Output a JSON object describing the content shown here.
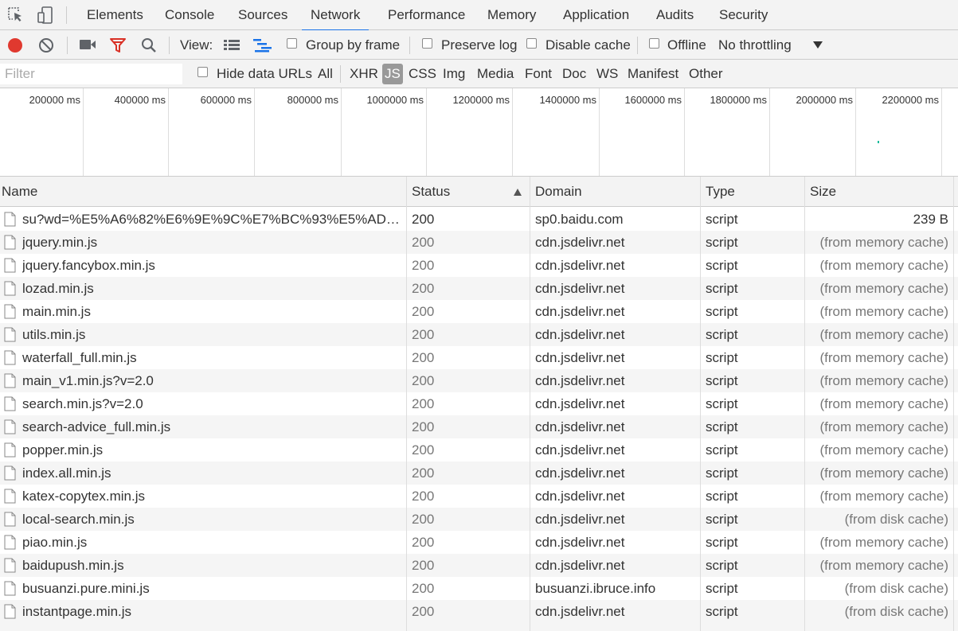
{
  "tabs": [
    "Elements",
    "Console",
    "Sources",
    "Network",
    "Performance",
    "Memory",
    "Application",
    "Audits",
    "Security"
  ],
  "active_tab": "Network",
  "toolbar": {
    "view_label": "View:",
    "group_by_frame": "Group by frame",
    "preserve_log": "Preserve log",
    "disable_cache": "Disable cache",
    "offline": "Offline",
    "throttling": "No throttling",
    "record_color": "#e0392f",
    "filter_icon_color": "#d93025"
  },
  "filterbar": {
    "placeholder": "Filter",
    "hide_data_urls": "Hide data URLs",
    "types": [
      "All",
      "XHR",
      "JS",
      "CSS",
      "Img",
      "Media",
      "Font",
      "Doc",
      "WS",
      "Manifest",
      "Other"
    ],
    "active_type": "JS"
  },
  "overview": {
    "ticks": [
      "200000 ms",
      "400000 ms",
      "600000 ms",
      "800000 ms",
      "1000000 ms",
      "1200000 ms",
      "1400000 ms",
      "1600000 ms",
      "1800000 ms",
      "2000000 ms",
      "2200000 ms"
    ]
  },
  "table": {
    "headers": {
      "name": "Name",
      "status": "Status",
      "domain": "Domain",
      "type": "Type",
      "size": "Size"
    },
    "sort_column": "Status",
    "rows": [
      {
        "name": "su?wd=%E5%A6%82%E6%9E%9C%E7%BC%93%E5%AD%98%...",
        "status": "200",
        "domain": "sp0.baidu.com",
        "type": "script",
        "size": "239 B"
      },
      {
        "name": "jquery.min.js",
        "status": "200",
        "domain": "cdn.jsdelivr.net",
        "type": "script",
        "size": "(from memory cache)"
      },
      {
        "name": "jquery.fancybox.min.js",
        "status": "200",
        "domain": "cdn.jsdelivr.net",
        "type": "script",
        "size": "(from memory cache)"
      },
      {
        "name": "lozad.min.js",
        "status": "200",
        "domain": "cdn.jsdelivr.net",
        "type": "script",
        "size": "(from memory cache)"
      },
      {
        "name": "main.min.js",
        "status": "200",
        "domain": "cdn.jsdelivr.net",
        "type": "script",
        "size": "(from memory cache)"
      },
      {
        "name": "utils.min.js",
        "status": "200",
        "domain": "cdn.jsdelivr.net",
        "type": "script",
        "size": "(from memory cache)"
      },
      {
        "name": "waterfall_full.min.js",
        "status": "200",
        "domain": "cdn.jsdelivr.net",
        "type": "script",
        "size": "(from memory cache)"
      },
      {
        "name": "main_v1.min.js?v=2.0",
        "status": "200",
        "domain": "cdn.jsdelivr.net",
        "type": "script",
        "size": "(from memory cache)"
      },
      {
        "name": "search.min.js?v=2.0",
        "status": "200",
        "domain": "cdn.jsdelivr.net",
        "type": "script",
        "size": "(from memory cache)"
      },
      {
        "name": "search-advice_full.min.js",
        "status": "200",
        "domain": "cdn.jsdelivr.net",
        "type": "script",
        "size": "(from memory cache)"
      },
      {
        "name": "popper.min.js",
        "status": "200",
        "domain": "cdn.jsdelivr.net",
        "type": "script",
        "size": "(from memory cache)"
      },
      {
        "name": "index.all.min.js",
        "status": "200",
        "domain": "cdn.jsdelivr.net",
        "type": "script",
        "size": "(from memory cache)"
      },
      {
        "name": "katex-copytex.min.js",
        "status": "200",
        "domain": "cdn.jsdelivr.net",
        "type": "script",
        "size": "(from memory cache)"
      },
      {
        "name": "local-search.min.js",
        "status": "200",
        "domain": "cdn.jsdelivr.net",
        "type": "script",
        "size": "(from disk cache)"
      },
      {
        "name": "piao.min.js",
        "status": "200",
        "domain": "cdn.jsdelivr.net",
        "type": "script",
        "size": "(from memory cache)"
      },
      {
        "name": "baidupush.min.js",
        "status": "200",
        "domain": "cdn.jsdelivr.net",
        "type": "script",
        "size": "(from memory cache)"
      },
      {
        "name": "busuanzi.pure.mini.js",
        "status": "200",
        "domain": "busuanzi.ibruce.info",
        "type": "script",
        "size": "(from disk cache)"
      },
      {
        "name": "instantpage.min.js",
        "status": "200",
        "domain": "cdn.jsdelivr.net",
        "type": "script",
        "size": "(from disk cache)"
      }
    ]
  }
}
